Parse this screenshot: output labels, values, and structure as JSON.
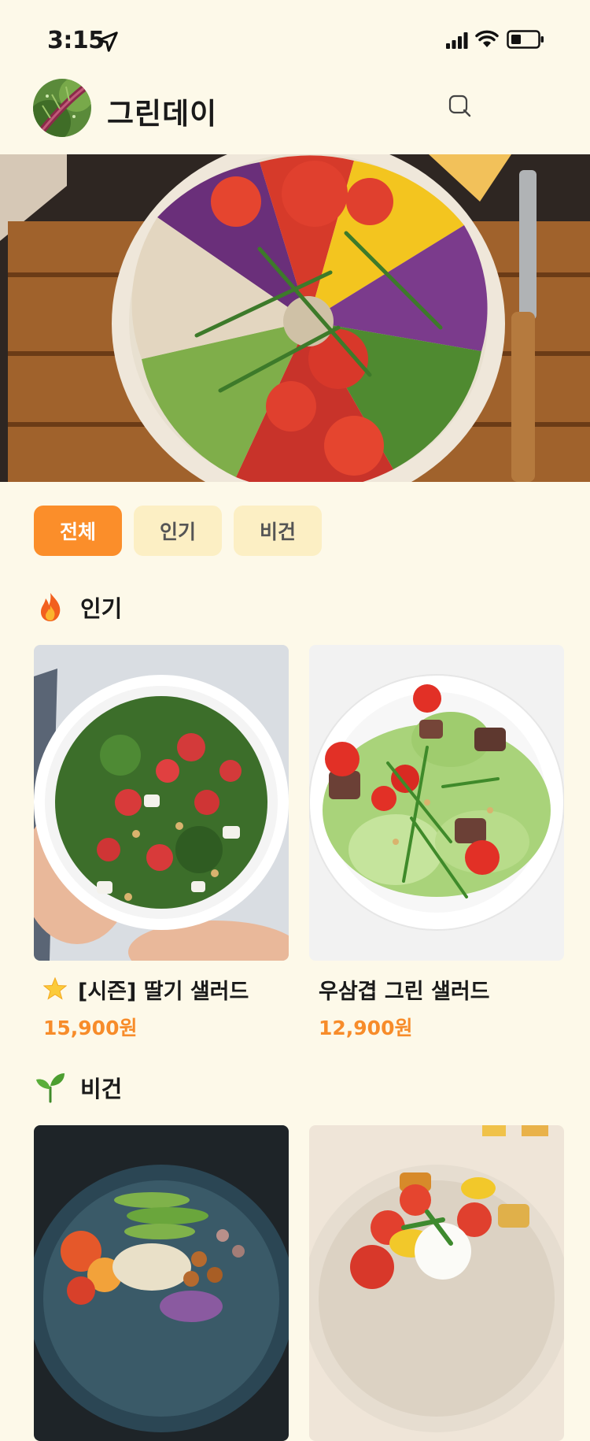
{
  "status_bar": {
    "time": "3:15"
  },
  "header": {
    "title": "그린데이"
  },
  "tabs": [
    {
      "label": "전체",
      "active": true
    },
    {
      "label": "인기",
      "active": false
    },
    {
      "label": "비건",
      "active": false
    }
  ],
  "sections": [
    {
      "title": "인기",
      "icon": "fire-icon",
      "items": [
        {
          "name": "[시즌] 딸기 샐러드",
          "price": "15,900원",
          "badge_icon": "star-icon"
        },
        {
          "name": "우삼겹 그린 샐러드",
          "price": "12,900원"
        }
      ]
    },
    {
      "title": "비건",
      "icon": "seedling-icon",
      "items": [
        {},
        {}
      ]
    }
  ],
  "colors": {
    "background": "#FDF9E9",
    "accent": "#FB8E2A",
    "chip": "#FCEFC4",
    "price": "#F78C2A"
  }
}
